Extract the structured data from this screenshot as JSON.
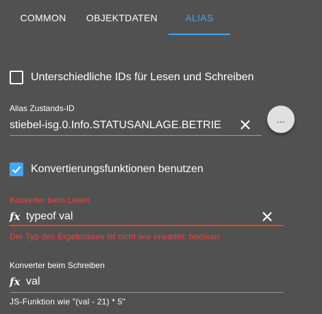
{
  "tabs": [
    {
      "label": "COMMON",
      "active": false
    },
    {
      "label": "OBJEKTDATEN",
      "active": false
    },
    {
      "label": "ALIAS",
      "active": true
    }
  ],
  "colors": {
    "background": "#515151",
    "accent": "#42a5f5",
    "error": "#f44336"
  },
  "different_ids": {
    "label": "Unterschiedliche IDs für Lesen und Schreiben",
    "checked": false
  },
  "alias_state_id": {
    "label": "Alias Zustands-ID",
    "value": "stiebel-isg.0.Info.STATUSANLAGE.BETRIE",
    "clear_icon": "close-icon",
    "more_button_label": "..."
  },
  "use_conversion": {
    "label": "Konvertierungsfunktionen benutzen",
    "checked": true
  },
  "read_converter": {
    "label": "Konverter beim Lesen",
    "icon": "fx-icon",
    "value": "typeof val",
    "clear_icon": "close-icon",
    "error_text": "Der Typ des Ergebnisses ist nicht wie erwartet: boolean"
  },
  "write_converter": {
    "label": "Konverter beim Schreiben",
    "icon": "fx-icon",
    "value": "val",
    "helper_text": "JS-Funktion wie \"(val - 21) * 5\""
  }
}
